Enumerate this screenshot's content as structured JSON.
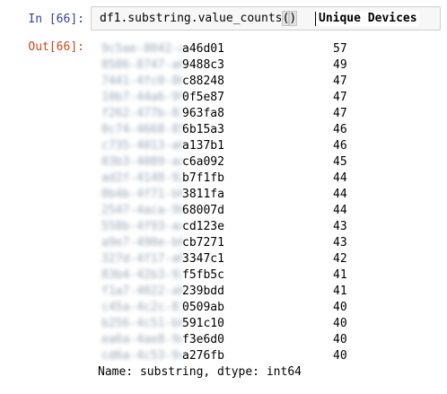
{
  "input_cell": {
    "prompt": "In [66]:",
    "code_before": "df1.substring.value_counts",
    "paren_open": "(",
    "paren_close": ")",
    "tooltip": "Unique Devices"
  },
  "output_cell": {
    "prompt": "Out[66]:",
    "rows": [
      {
        "blurred_prefix": "9c5ae-8042-ac22-6",
        "suffix": "a46d01",
        "count": "57"
      },
      {
        "blurred_prefix": "8586-8747-a0a5-a6",
        "suffix": "9488c3",
        "count": "49"
      },
      {
        "blurred_prefix": "7441-4fc0-861a-3b",
        "suffix": "c88248",
        "count": "47"
      },
      {
        "blurred_prefix": "10b7-44a6-9973-6a",
        "suffix": "0f5e87",
        "count": "47"
      },
      {
        "blurred_prefix": "f262-477b-83b2-f4",
        "suffix": "963fa8",
        "count": "47"
      },
      {
        "blurred_prefix": "0c74-4668-851d-60",
        "suffix": "6b15a3",
        "count": "46"
      },
      {
        "blurred_prefix": "c735-4013-a043-79",
        "suffix": "a137b1",
        "count": "46"
      },
      {
        "blurred_prefix": "03b3-4089-aac0-5b",
        "suffix": "c6a092",
        "count": "45"
      },
      {
        "blurred_prefix": "ad2f-4148-927a-d7",
        "suffix": "b7f1fb",
        "count": "44"
      },
      {
        "blurred_prefix": "0b4b-4f71-b638-fa",
        "suffix": "3811fa",
        "count": "44"
      },
      {
        "blurred_prefix": "2547-4aca-9b59-84",
        "suffix": "68007d",
        "count": "44"
      },
      {
        "blurred_prefix": "558b-4f93-aace-28",
        "suffix": "cd123e",
        "count": "43"
      },
      {
        "blurred_prefix": "a9e7-490e-b6c7-ed",
        "suffix": "cb7271",
        "count": "43"
      },
      {
        "blurred_prefix": "327d-4f17-a025-e0",
        "suffix": "3347c1",
        "count": "42"
      },
      {
        "blurred_prefix": "83b4-42b3-934d-0f",
        "suffix": "f5fb5c",
        "count": "41"
      },
      {
        "blurred_prefix": "f1a7-4022-aba0-c8",
        "suffix": "239bdd",
        "count": "41"
      },
      {
        "blurred_prefix": "c45a-4c2c-8122-a3",
        "suffix": "0509ab",
        "count": "40"
      },
      {
        "blurred_prefix": "b256-4c51-b825-16",
        "suffix": "591c10",
        "count": "40"
      },
      {
        "blurred_prefix": "ea6a-4ae8-9de9-87",
        "suffix": "f3e6d0",
        "count": "40"
      },
      {
        "blurred_prefix": "cd6a-4c53-9ca4-85",
        "suffix": "a276fb",
        "count": "40"
      }
    ],
    "footer": "Name: substring, dtype: int64"
  }
}
